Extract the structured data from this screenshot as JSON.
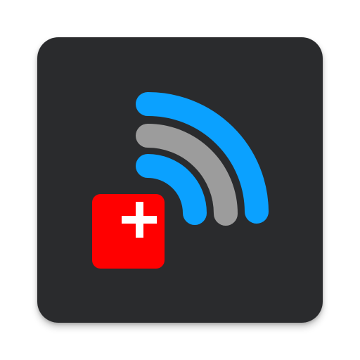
{
  "app_icon": {
    "icon_name": "wifi-plus-icon",
    "background_color": "#2a2b2d",
    "signal_waves": {
      "icon_name": "wifi-signal-icon",
      "outer_color": "#0ba1ff",
      "middle_color": "#9c9c9c",
      "inner_color": "#0ba1ff"
    },
    "badge": {
      "icon_name": "plus-icon",
      "background_color": "#ff0000",
      "symbol_color": "#ffffff"
    }
  }
}
